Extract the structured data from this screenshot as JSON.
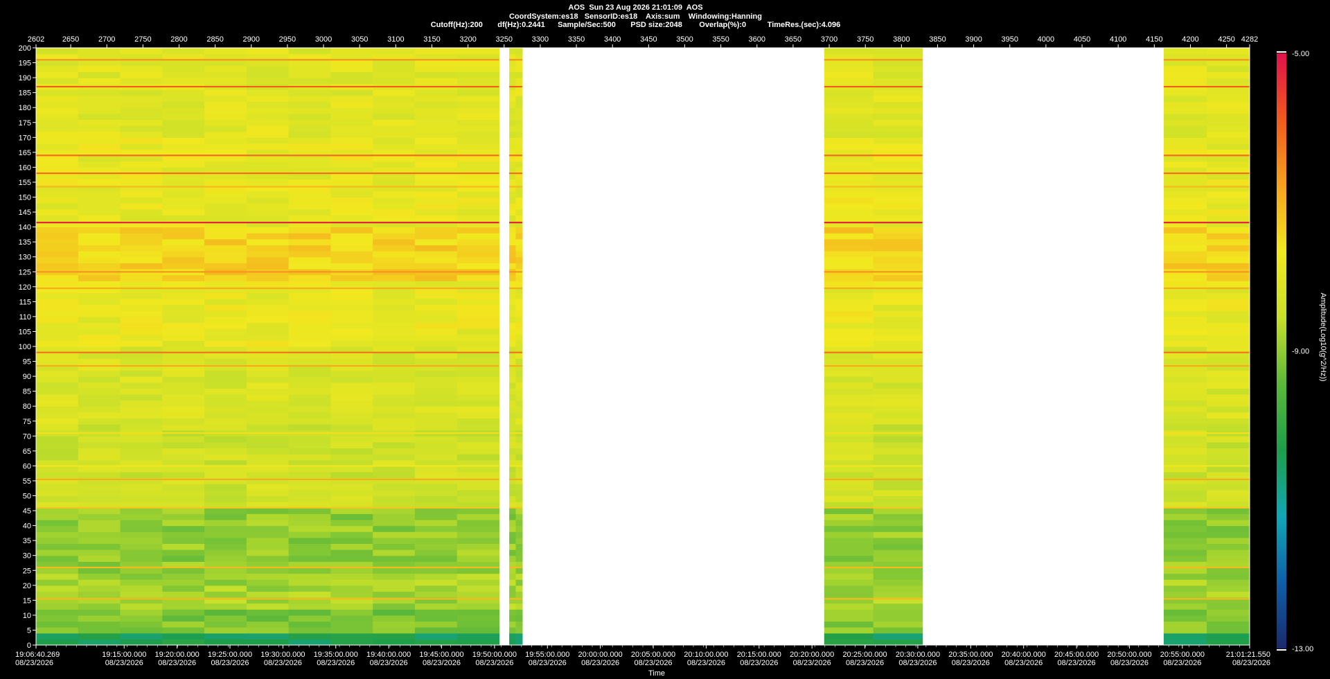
{
  "header": {
    "line1": "AOS  Sun 23 Aug 2026 21:01:09  AOS",
    "line2": "CoordSystem:es18   SensorID:es18    Axis:sum    Windowing:Hanning",
    "line3": "Cutoff(Hz):200       df(Hz):0.2441      Sample/Sec:500       PSD size:2048        Overlap(%):0          TimeRes.(sec):4.096"
  },
  "chart_data": {
    "type": "heatmap",
    "title": "AOS  Sun 23 Aug 2026 21:01:09  AOS",
    "xlabel": "Time",
    "ylabel": "",
    "colorbar_label": "Amplitude(Log10(g^2/Hz))",
    "top_axis_range": [
      2602,
      4282
    ],
    "top_axis_ticks": [
      "2602",
      "2650",
      "2700",
      "2750",
      "2800",
      "2850",
      "2900",
      "2950",
      "3000",
      "3050",
      "3100",
      "3150",
      "3200",
      "3250",
      "3300",
      "3350",
      "3400",
      "3450",
      "3500",
      "3550",
      "3600",
      "3650",
      "3700",
      "3750",
      "3800",
      "3850",
      "3900",
      "3950",
      "4000",
      "4050",
      "4100",
      "4150",
      "4200",
      "4250",
      "4282"
    ],
    "yrange": [
      0,
      200
    ],
    "y_ticks": [
      0,
      5,
      10,
      15,
      20,
      25,
      30,
      35,
      40,
      45,
      50,
      55,
      60,
      65,
      70,
      75,
      80,
      85,
      90,
      95,
      100,
      105,
      110,
      115,
      120,
      125,
      130,
      135,
      140,
      145,
      150,
      155,
      160,
      165,
      170,
      175,
      180,
      185,
      190,
      195,
      200
    ],
    "time_ticks": [
      {
        "time": "19:06:40.269",
        "date": "08/23/2026"
      },
      {
        "time": "19:15:00.000",
        "date": "08/23/2026"
      },
      {
        "time": "19:20:00.000",
        "date": "08/23/2026"
      },
      {
        "time": "19:25:00.000",
        "date": "08/23/2026"
      },
      {
        "time": "19:30:00.000",
        "date": "08/23/2026"
      },
      {
        "time": "19:35:00.000",
        "date": "08/23/2026"
      },
      {
        "time": "19:40:00.000",
        "date": "08/23/2026"
      },
      {
        "time": "19:45:00.000",
        "date": "08/23/2026"
      },
      {
        "time": "19:50:00.000",
        "date": "08/23/2026"
      },
      {
        "time": "19:55:00.000",
        "date": "08/23/2026"
      },
      {
        "time": "20:00:00.000",
        "date": "08/23/2026"
      },
      {
        "time": "20:05:00.000",
        "date": "08/23/2026"
      },
      {
        "time": "20:10:00.000",
        "date": "08/23/2026"
      },
      {
        "time": "20:15:00.000",
        "date": "08/23/2026"
      },
      {
        "time": "20:20:00.000",
        "date": "08/23/2026"
      },
      {
        "time": "20:25:00.000",
        "date": "08/23/2026"
      },
      {
        "time": "20:30:00.000",
        "date": "08/23/2026"
      },
      {
        "time": "20:35:00.000",
        "date": "08/23/2026"
      },
      {
        "time": "20:40:00.000",
        "date": "08/23/2026"
      },
      {
        "time": "20:45:00.000",
        "date": "08/23/2026"
      },
      {
        "time": "20:50:00.000",
        "date": "08/23/2026"
      },
      {
        "time": "20:55:00.000",
        "date": "08/23/2026"
      },
      {
        "time": "21:01:21.550",
        "date": "08/23/2026"
      }
    ],
    "colorbar_range": [
      -13.0,
      -5.0
    ],
    "colorbar_ticks": [
      "-5.00",
      "-9.00",
      "-13.00"
    ],
    "colormap": [
      "#1a2a6c",
      "#0f5fa8",
      "#11a7b5",
      "#1e9e4a",
      "#5bb83a",
      "#c7e02a",
      "#f2e81f",
      "#f6a21e",
      "#f05a1e",
      "#e0114a"
    ],
    "data_segments": [
      {
        "x_start": 2602,
        "x_end": 3243
      },
      {
        "x_start": 3257,
        "x_end": 3275
      },
      {
        "x_start": 3693,
        "x_end": 3829
      },
      {
        "x_start": 4163,
        "x_end": 4282
      }
    ],
    "base_levels": [
      {
        "y0": 0,
        "y1": 4,
        "level": 0.32
      },
      {
        "y0": 4,
        "y1": 12,
        "level": 0.48
      },
      {
        "y0": 12,
        "y1": 25,
        "level": 0.52
      },
      {
        "y0": 25,
        "y1": 46,
        "level": 0.5
      },
      {
        "y0": 46,
        "y1": 56,
        "level": 0.58
      },
      {
        "y0": 56,
        "y1": 75,
        "level": 0.58
      },
      {
        "y0": 75,
        "y1": 100,
        "level": 0.6
      },
      {
        "y0": 100,
        "y1": 122,
        "level": 0.64
      },
      {
        "y0": 122,
        "y1": 140,
        "level": 0.7
      },
      {
        "y0": 140,
        "y1": 170,
        "level": 0.64
      },
      {
        "y0": 170,
        "y1": 200,
        "level": 0.62
      }
    ],
    "spectral_lines": [
      {
        "freq": 141.5,
        "level": 0.98
      },
      {
        "freq": 187,
        "level": 0.88
      },
      {
        "freq": 164,
        "level": 0.86
      },
      {
        "freq": 158,
        "level": 0.86
      },
      {
        "freq": 98,
        "level": 0.85
      },
      {
        "freq": 196,
        "level": 0.8
      },
      {
        "freq": 55.5,
        "level": 0.76
      },
      {
        "freq": 93.5,
        "level": 0.76
      },
      {
        "freq": 153.5,
        "level": 0.74
      },
      {
        "freq": 46,
        "level": 0.72
      },
      {
        "freq": 26,
        "level": 0.74
      },
      {
        "freq": 15.5,
        "level": 0.74
      },
      {
        "freq": 125,
        "level": 0.8
      },
      {
        "freq": 119.5,
        "level": 0.76
      },
      {
        "freq": 71,
        "level": 0.68
      },
      {
        "freq": 60,
        "level": 0.66
      }
    ]
  }
}
